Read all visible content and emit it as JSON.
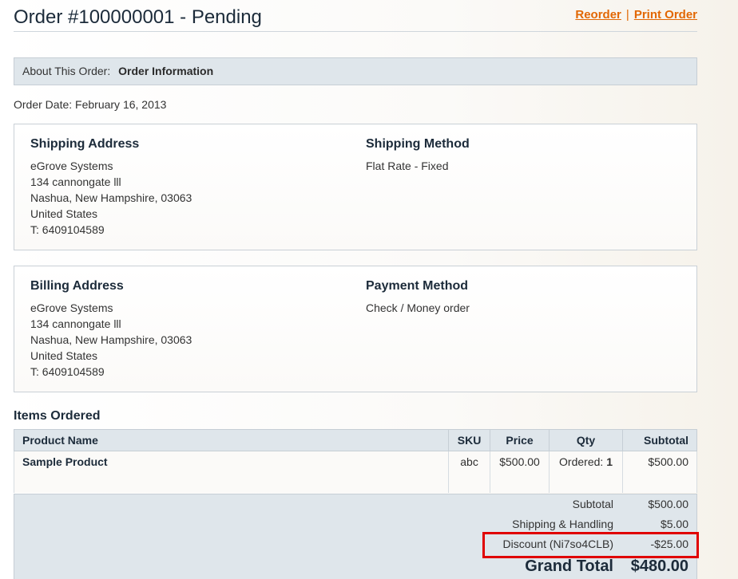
{
  "header": {
    "title": "Order #100000001 - Pending",
    "reorder": "Reorder",
    "separator": "|",
    "print": "Print Order"
  },
  "about": {
    "label": "About This Order:",
    "current": "Order Information"
  },
  "order_date": "Order Date: February 16, 2013",
  "shipping": {
    "address_title": "Shipping Address",
    "address_lines": [
      "eGrove Systems",
      "134 cannongate lll",
      "Nashua, New Hampshire, 03063",
      "United States",
      "T: 6409104589"
    ],
    "method_title": "Shipping Method",
    "method": "Flat Rate - Fixed"
  },
  "billing": {
    "address_title": "Billing Address",
    "address_lines": [
      "eGrove Systems",
      "134 cannongate lll",
      "Nashua, New Hampshire, 03063",
      "United States",
      "T: 6409104589"
    ],
    "method_title": "Payment Method",
    "method": "Check / Money order"
  },
  "items": {
    "title": "Items Ordered",
    "columns": [
      "Product Name",
      "SKU",
      "Price",
      "Qty",
      "Subtotal"
    ],
    "rows": [
      {
        "name": "Sample Product",
        "sku": "abc",
        "price": "$500.00",
        "qty_label": "Ordered:",
        "qty": "1",
        "subtotal": "$500.00"
      }
    ]
  },
  "totals": {
    "subtotal_label": "Subtotal",
    "subtotal": "$500.00",
    "shipping_label": "Shipping & Handling",
    "shipping": "$5.00",
    "discount_label": "Discount (Ni7so4CLB)",
    "discount": "-$25.00",
    "grand_label": "Grand Total",
    "grand": "$480.00"
  },
  "colors": {
    "link": "#e26703",
    "highlight": "#e00000",
    "header_bg": "#dfe6eb"
  }
}
